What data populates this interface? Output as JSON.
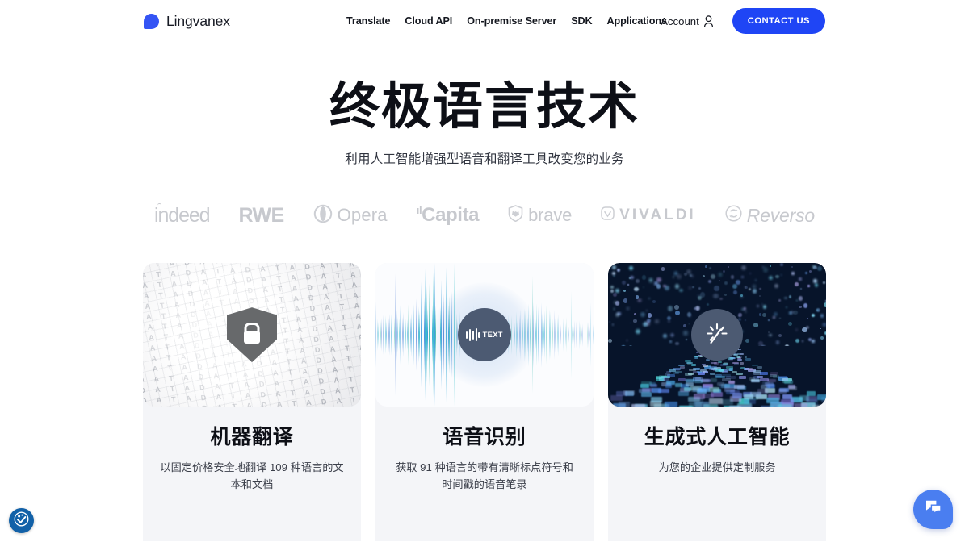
{
  "brand": {
    "name": "Lingvanex",
    "logo_icon": "droplet-logo-icon",
    "accent": "#1f45f5"
  },
  "nav": {
    "items": [
      {
        "label": "Translate"
      },
      {
        "label": "Cloud API"
      },
      {
        "label": "On-premise Server"
      },
      {
        "label": "SDK"
      },
      {
        "label": "Applications"
      }
    ]
  },
  "header_right": {
    "account_label": "Account",
    "account_icon": "user-icon",
    "contact_label": "CONTACT US"
  },
  "hero": {
    "title": "终极语言技术",
    "subtitle": "利用人工智能增强型语音和翻译工具改变您的业务"
  },
  "logos": [
    {
      "name": "indeed",
      "label": "indeed",
      "icon": "indeed-dot-icon"
    },
    {
      "name": "rwe",
      "label": "RWE",
      "icon": ""
    },
    {
      "name": "opera",
      "label": "Opera",
      "icon": "opera-o-icon"
    },
    {
      "name": "capita",
      "label": "Capita",
      "icon": "capita-tick-icon"
    },
    {
      "name": "brave",
      "label": "brave",
      "icon": "brave-lion-icon"
    },
    {
      "name": "vivaldi",
      "label": "VIVALDI",
      "icon": "vivaldi-shield-icon"
    },
    {
      "name": "reverso",
      "label": "Reverso",
      "icon": "reverso-circle-arrows-icon"
    }
  ],
  "cards": [
    {
      "id": "machine-translation",
      "title": "机器翻译",
      "desc": "以固定价格安全地翻译 109 种语言的文本和文档",
      "media_icon": "shield-lock-icon",
      "media_alt": "data-grid-background"
    },
    {
      "id": "speech-recognition",
      "title": "语音识别",
      "desc": "获取 91 种语言的带有清晰标点符号和时间戳的语音笔录",
      "media_icon": "audio-to-text-icon",
      "media_badge_label": "TEXT",
      "media_alt": "audio-waveform-background"
    },
    {
      "id": "generative-ai",
      "title": "生成式人工智能",
      "desc": "为您的企业提供定制服务",
      "media_icon": "magic-wand-icon",
      "media_alt": "digital-landscape-background"
    }
  ],
  "widgets": {
    "accessibility_icon": "accessibility-icon",
    "chat_icon": "chat-bubble-icon",
    "chat_color": "#4a7ef0",
    "accessibility_color": "#1261a8"
  }
}
